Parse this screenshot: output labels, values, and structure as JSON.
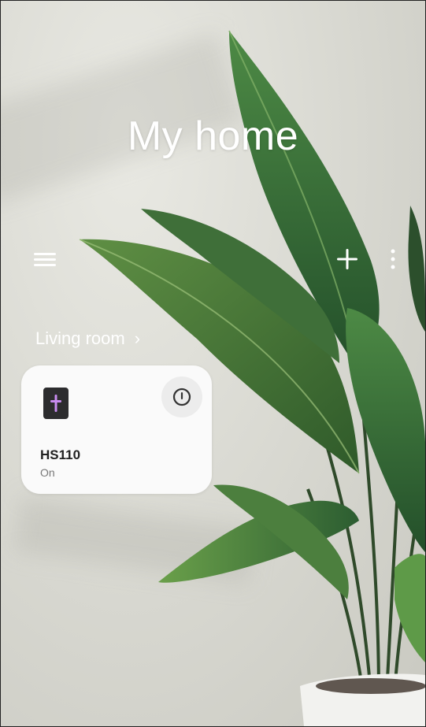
{
  "header": {
    "title": "My home"
  },
  "toolbar": {
    "menu_icon": "hamburger-menu-icon",
    "add_icon": "plus-icon",
    "more_icon": "vertical-ellipsis-icon"
  },
  "room": {
    "label": "Living room",
    "chevron": "›"
  },
  "devices": [
    {
      "name": "HS110",
      "status": "On",
      "icon": "smart-plug-icon",
      "action_icon": "power-icon"
    }
  ],
  "colors": {
    "accent": "#c080e0",
    "card": "#fafafa",
    "text_on_bg": "#ffffff"
  }
}
